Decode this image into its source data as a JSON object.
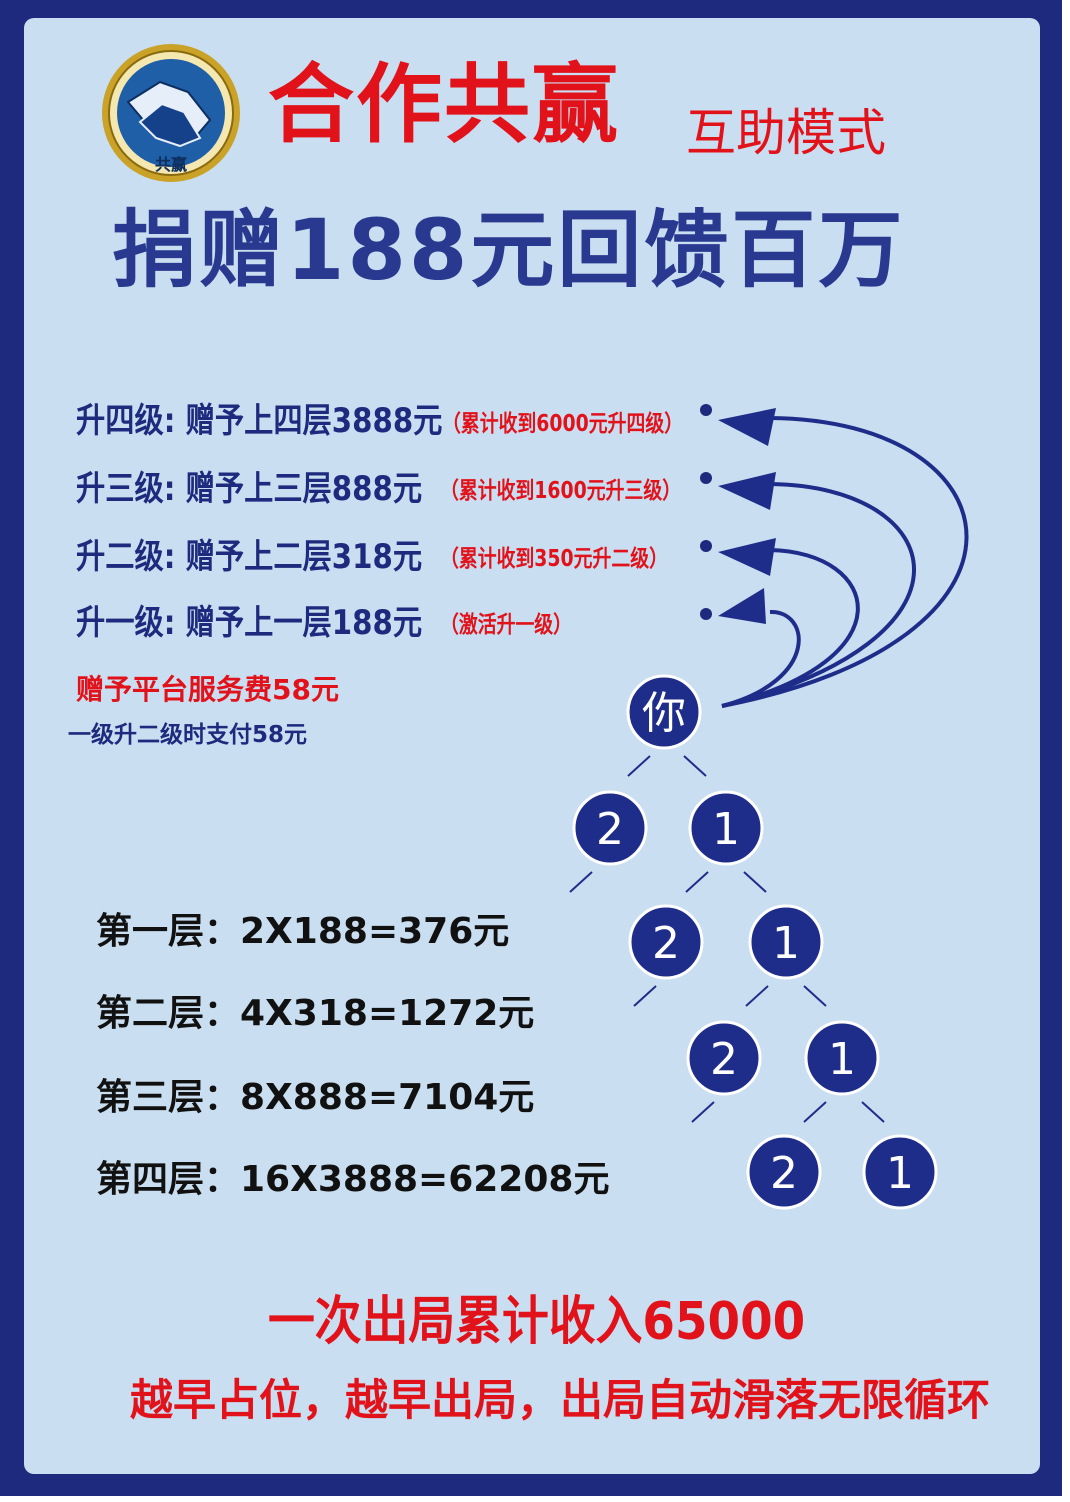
{
  "header": {
    "title": "合作共赢",
    "subtitle": "互助模式",
    "headline": "捐赠188元回馈百万",
    "logo_text": "共赢"
  },
  "levels": [
    {
      "label": "升四级: 赠予上四层3888元",
      "note": "（累计收到6000元升四级）"
    },
    {
      "label": "升三级: 赠予上三层888元",
      "note": "（累计收到1600元升三级）"
    },
    {
      "label": "升二级: 赠予上二层318元",
      "note": "（累计收到350元升二级）"
    },
    {
      "label": "升一级: 赠予上一层188元",
      "note": "（激活升一级）"
    }
  ],
  "fee": {
    "title": "赠予平台服务费58元",
    "note": "一级升二级时支付58元"
  },
  "layers": [
    "第一层：2X188=376元",
    "第二层：4X318=1272元",
    "第三层：8X888=7104元",
    "第四层：16X3888=62208元"
  ],
  "tree": {
    "root": "你",
    "left": "2",
    "right": "1"
  },
  "footer": {
    "line1": "一次出局累计收入65000",
    "line2": "越早占位，越早出局，出局自动滑落无限循环"
  },
  "colors": {
    "frame": "#1d2a7d",
    "panel": "#c9def0",
    "red": "#e2121b",
    "node": "#1f2d8a"
  }
}
